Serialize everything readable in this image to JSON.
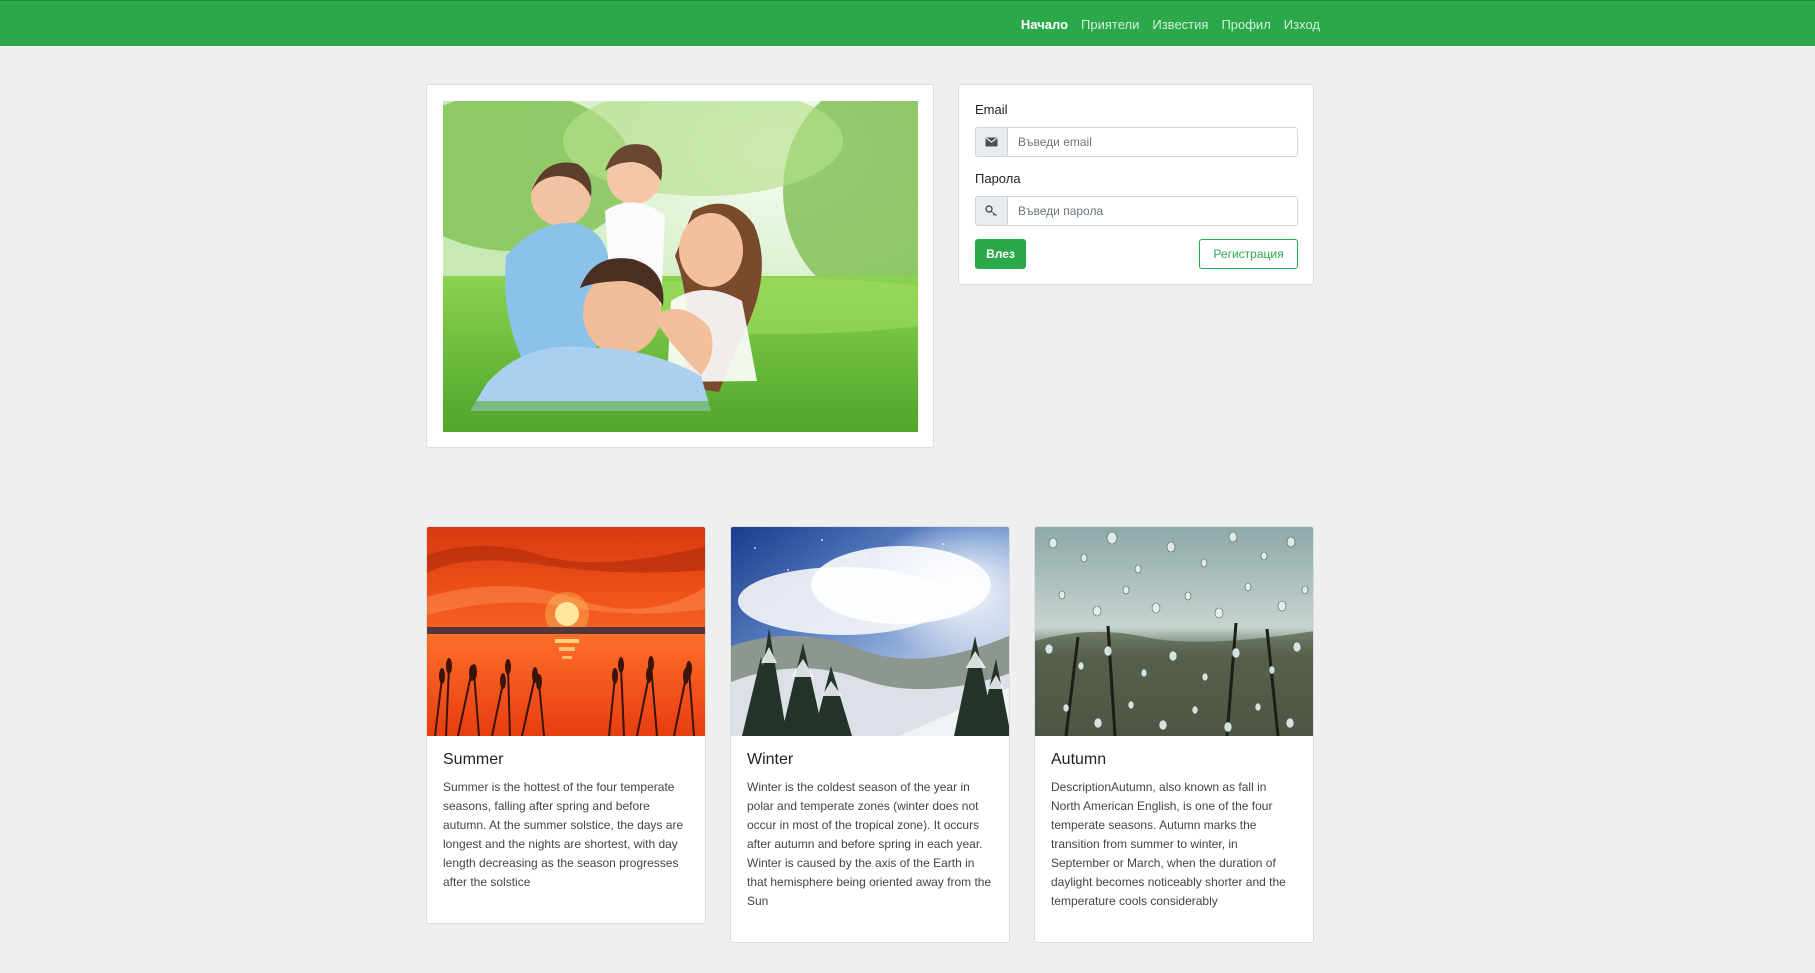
{
  "nav": {
    "items": [
      {
        "label": "Начало"
      },
      {
        "label": "Приятели"
      },
      {
        "label": "Известия"
      },
      {
        "label": "Профил"
      },
      {
        "label": "Изход"
      }
    ],
    "active_index": 0
  },
  "login": {
    "email_label": "Email",
    "email_placeholder": "Въведи email",
    "password_label": "Парола",
    "password_placeholder": "Въведи парола",
    "login_button": "Влез",
    "register_button": "Регистрация"
  },
  "hero": {
    "image_icon": "family-photo"
  },
  "seasons": [
    {
      "title": "Summer",
      "text": "Summer is the hottest of the four temperate seasons, falling after spring and before autumn. At the summer solstice, the days are longest and the nights are shortest, with day length decreasing as the season progresses after the solstice",
      "image_icon": "sunset-photo"
    },
    {
      "title": "Winter",
      "text": "Winter is the coldest season of the year in polar and temperate zones (winter does not occur in most of the tropical zone). It occurs after autumn and before spring in each year. Winter is caused by the axis of the Earth in that hemisphere being oriented away from the Sun",
      "image_icon": "snowy-forest-photo"
    },
    {
      "title": "Autumn",
      "text": "DescriptionAutumn, also known as fall in North American English, is one of the four temperate seasons. Autumn marks the transition from summer to winter, in September or March, when the duration of daylight becomes noticeably shorter and the temperature cools considerably",
      "image_icon": "rainy-window-photo"
    }
  ],
  "colors": {
    "primary": "#2ba84a",
    "background": "#efefef",
    "card_border": "#dcdcdc"
  }
}
